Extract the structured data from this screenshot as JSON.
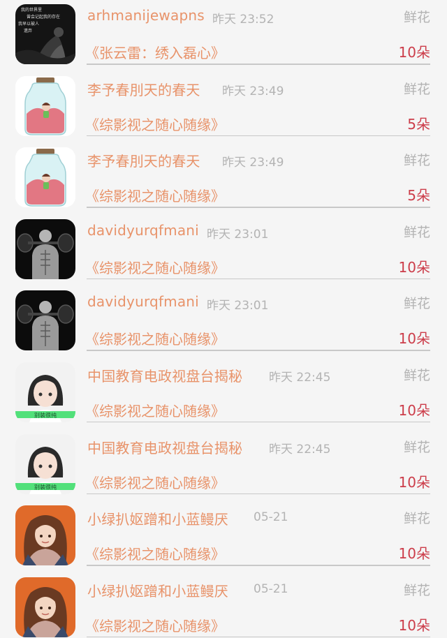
{
  "rows": [
    {
      "name": "arhmanijewapns",
      "time": "昨天 23:52",
      "gift_label": "鲜花",
      "book": "《张云雷：绣入磊心》",
      "count": "10朵",
      "avatar": {
        "icon": "dark-poster-avatar",
        "caption_lines": [
          "我的世界里",
          "曾会记起我的存在",
          "我早以被人",
          "遗弃"
        ]
      }
    },
    {
      "name": "李予春刖天的春天",
      "time": "昨天 23:49",
      "gift_label": "鲜花",
      "book": "《综影视之随心随缘》",
      "count": "5朵",
      "avatar": {
        "icon": "jar-girl-avatar"
      }
    },
    {
      "name": "李予春刖天的春天",
      "time": "昨天 23:49",
      "gift_label": "鲜花",
      "book": "《综影视之随心随缘》",
      "count": "5朵",
      "avatar": {
        "icon": "jar-girl-avatar"
      }
    },
    {
      "name": "davidyurqfmani",
      "time": "昨天 23:01",
      "gift_label": "鲜花",
      "book": "《综影视之随心随缘》",
      "count": "10朵",
      "avatar": {
        "icon": "muscle-man-avatar"
      }
    },
    {
      "name": "davidyurqfmani",
      "time": "昨天 23:01",
      "gift_label": "鲜花",
      "book": "《综影视之随心随缘》",
      "count": "10朵",
      "avatar": {
        "icon": "muscle-man-avatar"
      }
    },
    {
      "name": "中国教育电政视盘台揭秘",
      "time": "昨天 22:45",
      "gift_label": "鲜花",
      "book": "《综影视之随心随缘》",
      "count": "10朵",
      "avatar": {
        "icon": "anime-girl-avatar",
        "caption": "别装很纯"
      }
    },
    {
      "name": "中国教育电政视盘台揭秘",
      "time": "昨天 22:45",
      "gift_label": "鲜花",
      "book": "《综影视之随心随缘》",
      "count": "10朵",
      "avatar": {
        "icon": "anime-girl-avatar",
        "caption": "别装很纯"
      }
    },
    {
      "name": "小绿扒妪蹭和小蓝鳗厌",
      "time": "05-21",
      "gift_label": "鲜花",
      "book": "《综影视之随心随缘》",
      "count": "10朵",
      "avatar": {
        "icon": "curly-hair-girl-avatar"
      }
    },
    {
      "name": "小绿扒妪蹭和小蓝鳗厌",
      "time": "05-21",
      "gift_label": "鲜花",
      "book": "《综影视之随心随缘》",
      "count": "10朵",
      "avatar": {
        "icon": "curly-hair-girl-avatar"
      }
    }
  ],
  "colors": {
    "name": "#e8936a",
    "count": "#cc3d4a",
    "muted": "#b3b3b3",
    "divider": "#c8c8c8",
    "background": "#f5f5f5"
  }
}
